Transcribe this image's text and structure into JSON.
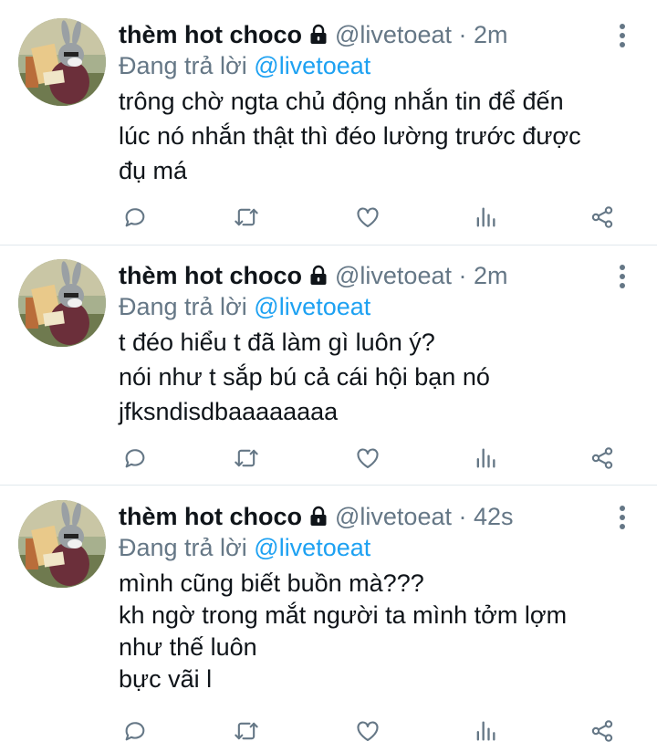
{
  "tweets": [
    {
      "name": "thèm hot choco",
      "handle": "@livetoeat",
      "separator": "·",
      "time": "2m",
      "reply_prefix": "Đang trả lời",
      "reply_to": "@livetoeat",
      "lines": [
        "trông chờ ngta chủ động nhắn tin để đến",
        "lúc nó nhắn thật thì đéo lường trước được",
        "đụ má"
      ]
    },
    {
      "name": "thèm hot choco",
      "handle": "@livetoeat",
      "separator": "·",
      "time": "2m",
      "reply_prefix": "Đang trả lời",
      "reply_to": "@livetoeat",
      "lines": [
        "t đéo hiểu t đã làm gì luôn ý?",
        "nói như t sắp bú cả cái hội bạn nó",
        "jfksndisdbaaaaaaaa"
      ]
    },
    {
      "name": "thèm hot choco",
      "handle": "@livetoeat",
      "separator": "·",
      "time": "42s",
      "reply_prefix": "Đang trả lời",
      "reply_to": "@livetoeat",
      "lines": [
        "mình cũng biết buồn mà???",
        "kh ngờ trong mắt người ta mình tởm lợm",
        "như thế luôn",
        "bực vãi l"
      ]
    }
  ],
  "icons": [
    "reply-icon",
    "retweet-icon",
    "like-icon",
    "analytics-icon",
    "share-icon",
    "more-icon",
    "lock-icon"
  ],
  "colors": {
    "text": "#0f1419",
    "muted": "#657786",
    "link": "#1da1f2",
    "divider": "#e1e8ed"
  }
}
